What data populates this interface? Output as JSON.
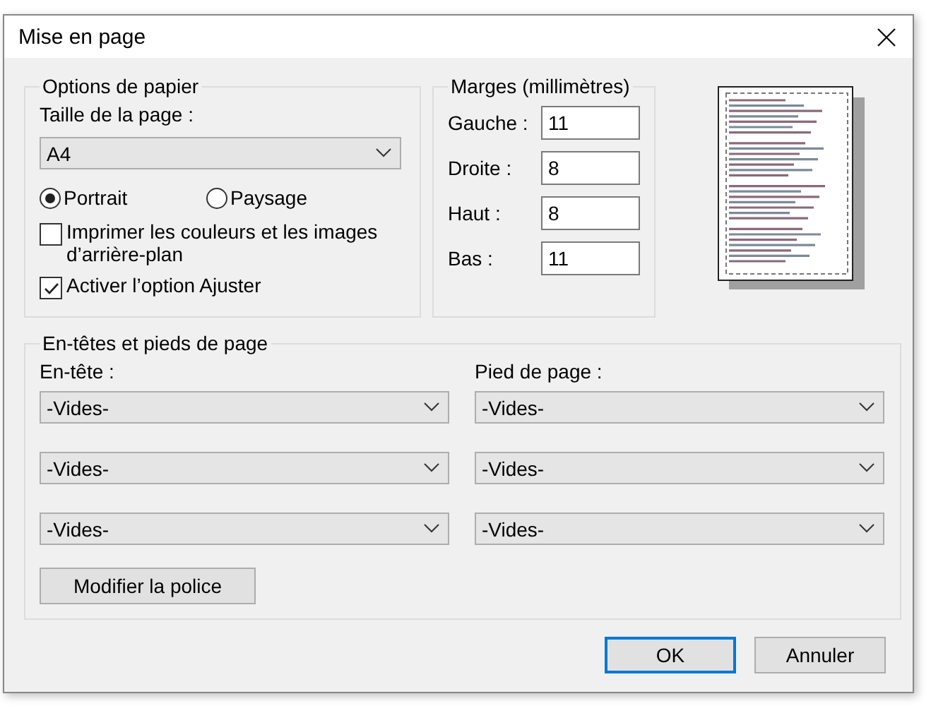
{
  "window": {
    "title": "Mise en page"
  },
  "paper_options": {
    "legend": "Options de papier",
    "size_label": "Taille de la page :",
    "size_value": "A4",
    "orientation": [
      {
        "label": "Portrait",
        "selected": true
      },
      {
        "label": "Paysage",
        "selected": false
      }
    ],
    "checkboxes": [
      {
        "label": "Imprimer les couleurs et les images d’arrière-plan",
        "checked": false
      },
      {
        "label": "Activer l’option Ajuster",
        "checked": true
      }
    ]
  },
  "margins": {
    "legend": "Marges (millimètres)",
    "fields": [
      {
        "label": "Gauche :",
        "value": "11"
      },
      {
        "label": "Droite :",
        "value": "8"
      },
      {
        "label": "Haut :",
        "value": "8"
      },
      {
        "label": "Bas :",
        "value": "11"
      }
    ]
  },
  "headers_footers": {
    "legend": "En-têtes et pieds de page",
    "header_label": "En-tête :",
    "footer_label": "Pied de page :",
    "header_values": [
      "-Vides-",
      "-Vides-",
      "-Vides-"
    ],
    "footer_values": [
      "-Vides-",
      "-Vides-",
      "-Vides-"
    ],
    "font_button": "Modifier la police"
  },
  "buttons": [
    {
      "label": "OK",
      "default": true
    },
    {
      "label": "Annuler",
      "default": false
    }
  ]
}
